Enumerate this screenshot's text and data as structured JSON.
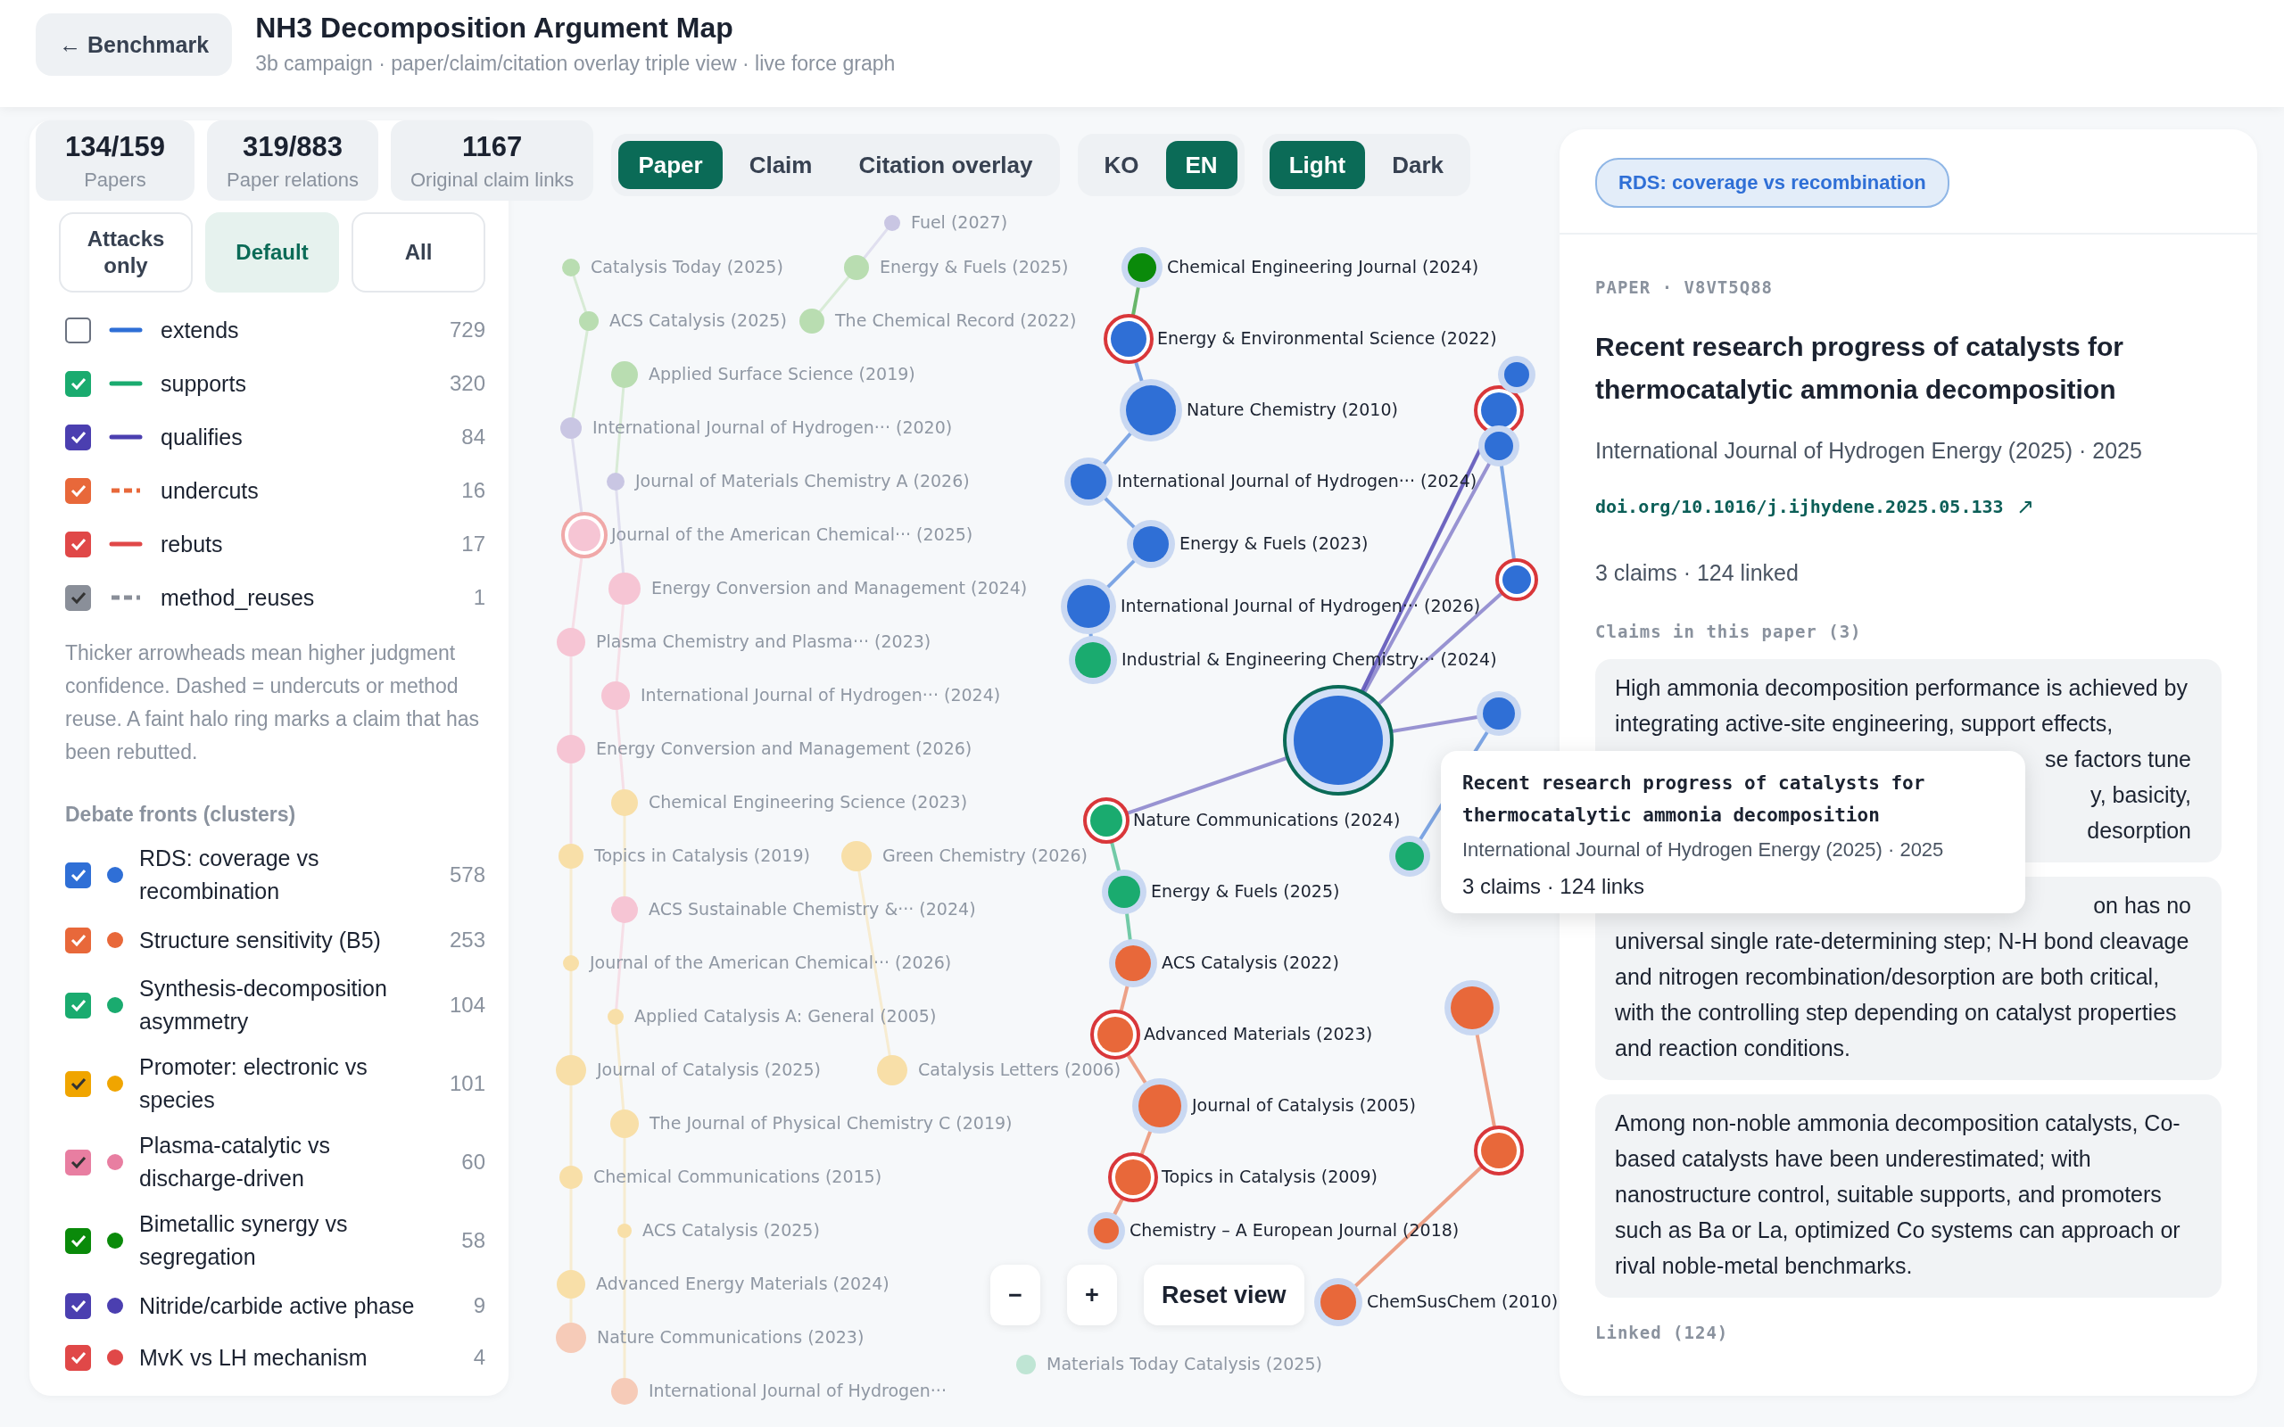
{
  "header": {
    "back_button": "← Benchmark",
    "title": "NH3 Decomposition Argument Map",
    "subtitle": "3b campaign · paper/claim/citation overlay triple view · live force graph"
  },
  "stats": [
    {
      "value": "134/159",
      "label": "Papers"
    },
    {
      "value": "319/883",
      "label": "Paper relations"
    },
    {
      "value": "1167",
      "label": "Original claim links"
    }
  ],
  "view_tabs": [
    {
      "label": "Paper",
      "selected": true
    },
    {
      "label": "Claim",
      "selected": false
    },
    {
      "label": "Citation overlay",
      "selected": false
    }
  ],
  "language": [
    {
      "label": "KO",
      "selected": false
    },
    {
      "label": "EN",
      "selected": true
    }
  ],
  "theme": [
    {
      "label": "Light",
      "selected": true
    },
    {
      "label": "Dark",
      "selected": false
    }
  ],
  "filters": [
    {
      "label": "Attacks only",
      "selected": false
    },
    {
      "label": "Default",
      "selected": true
    },
    {
      "label": "All",
      "selected": false
    }
  ],
  "edge_types": [
    {
      "label": "extends",
      "color": "#2f6fd6",
      "kind": "solid",
      "checked": false,
      "count": "729"
    },
    {
      "label": "supports",
      "color": "#1aab6f",
      "kind": "solid",
      "checked": true,
      "count": "320"
    },
    {
      "label": "qualifies",
      "color": "#4b3fb0",
      "kind": "solid",
      "checked": true,
      "count": "84"
    },
    {
      "label": "undercuts",
      "color": "#e8683a",
      "kind": "dashed",
      "checked": true,
      "count": "16"
    },
    {
      "label": "rebuts",
      "color": "#e04848",
      "kind": "solid",
      "checked": true,
      "count": "17"
    },
    {
      "label": "method_reuses",
      "color": "#8a8f99",
      "kind": "dashed",
      "checked": true,
      "count": "1"
    }
  ],
  "legend_note": "Thicker arrowheads mean higher judgment confidence. Dashed = undercuts or method reuse. A faint halo ring marks a claim that has been rebutted.",
  "clusters_title": "Debate fronts (clusters)",
  "clusters": [
    {
      "label": "RDS: coverage vs recombination",
      "color": "#2f6fd6",
      "checked": true,
      "count": "578"
    },
    {
      "label": "Structure sensitivity (B5)",
      "color": "#e8683a",
      "checked": true,
      "count": "253"
    },
    {
      "label": "Synthesis-decomposition asymmetry",
      "color": "#1aab6f",
      "checked": true,
      "count": "104"
    },
    {
      "label": "Promoter: electronic vs species",
      "color": "#f0a500",
      "checked": true,
      "count": "101"
    },
    {
      "label": "Plasma-catalytic vs discharge-driven",
      "color": "#e87ea1",
      "checked": true,
      "count": "60"
    },
    {
      "label": "Bimetallic synergy vs segregation",
      "color": "#0a8a0a",
      "checked": true,
      "count": "58"
    },
    {
      "label": "Nitride/carbide active phase",
      "color": "#4b3fb0",
      "checked": true,
      "count": "9"
    },
    {
      "label": "MvK vs LH mechanism",
      "color": "#e04848",
      "checked": true,
      "count": "4"
    }
  ],
  "graph": {
    "nodes": [
      {
        "label": "Fuel (2027)",
        "color": "#c9c6e3",
        "active": false,
        "rebutted": false
      },
      {
        "label": "Catalysis Today (2025)",
        "color": "#b9ddb1",
        "active": false,
        "rebutted": false
      },
      {
        "label": "Energy & Fuels (2025)",
        "color": "#b9ddb1",
        "active": false,
        "rebutted": false
      },
      {
        "label": "ACS Catalysis (2025)",
        "color": "#b9ddb1",
        "active": false,
        "rebutted": false
      },
      {
        "label": "The Chemical Record (2022)",
        "color": "#b9ddb1",
        "active": false,
        "rebutted": false
      },
      {
        "label": "Applied Surface Science (2019)",
        "color": "#b9ddb1",
        "active": false,
        "rebutted": false
      },
      {
        "label": "International Journal of Hydrogen··· (2020)",
        "color": "#c9c6e3",
        "active": false,
        "rebutted": false
      },
      {
        "label": "Journal of Materials Chemistry A (2026)",
        "color": "#c9c6e3",
        "active": false,
        "rebutted": false
      },
      {
        "label": "Journal of the American Chemical··· (2025)",
        "color": "#f6c5d4",
        "active": false,
        "rebutted": true
      },
      {
        "label": "Energy Conversion and Management (2024)",
        "color": "#f6c5d4",
        "active": false,
        "rebutted": false
      },
      {
        "label": "Plasma Chemistry and Plasma··· (2023)",
        "color": "#f6c5d4",
        "active": false,
        "rebutted": false
      },
      {
        "label": "International Journal of Hydrogen··· (2024)",
        "color": "#f6c5d4",
        "active": false,
        "rebutted": false
      },
      {
        "label": "Energy Conversion and Management (2026)",
        "color": "#f6c5d4",
        "active": false,
        "rebutted": false
      },
      {
        "label": "Chemical Engineering Science (2023)",
        "color": "#f8dfa8",
        "active": false,
        "rebutted": false
      },
      {
        "label": "Topics in Catalysis (2019)",
        "color": "#f8dfa8",
        "active": false,
        "rebutted": false
      },
      {
        "label": "Green Chemistry (2026)",
        "color": "#f8dfa8",
        "active": false,
        "rebutted": false
      },
      {
        "label": "ACS Sustainable Chemistry &··· (2024)",
        "color": "#f6c5d4",
        "active": false,
        "rebutted": false
      },
      {
        "label": "Journal of the American Chemical··· (2026)",
        "color": "#f8dfa8",
        "active": false,
        "rebutted": false
      },
      {
        "label": "Applied Catalysis A: General (2005)",
        "color": "#f8dfa8",
        "active": false,
        "rebutted": false
      },
      {
        "label": "Journal of Catalysis (2025)",
        "color": "#f8dfa8",
        "active": false,
        "rebutted": false
      },
      {
        "label": "Catalysis Letters (2006)",
        "color": "#f8dfa8",
        "active": false,
        "rebutted": false
      },
      {
        "label": "The Journal of Physical Chemistry C (2019)",
        "color": "#f8dfa8",
        "active": false,
        "rebutted": false
      },
      {
        "label": "Chemical Communications (2015)",
        "color": "#f8dfa8",
        "active": false,
        "rebutted": false
      },
      {
        "label": "ACS Catalysis (2025)",
        "color": "#f8dfa8",
        "active": false,
        "rebutted": false
      },
      {
        "label": "Advanced Energy Materials (2024)",
        "color": "#f8dfa8",
        "active": false,
        "rebutted": false
      },
      {
        "label": "Nature Communications (2023)",
        "color": "#f6cbb8",
        "active": false,
        "rebutted": false
      },
      {
        "label": "International Journal of Hydrogen···",
        "color": "#f6cbb8",
        "active": false,
        "rebutted": false
      },
      {
        "label": "Materials Today Catalysis (2025)",
        "color": "#bfe5d4",
        "active": false,
        "rebutted": false
      },
      {
        "label": "Chemical Engineering Journal (2024)",
        "color": "#0a8a0a",
        "active": true,
        "rebutted": false
      },
      {
        "label": "Energy & Environmental Science (2022)",
        "color": "#2f6fd6",
        "active": true,
        "rebutted": true
      },
      {
        "label": "Nature Chemistry (2010)",
        "color": "#2f6fd6",
        "active": true,
        "rebutted": false
      },
      {
        "label": "International Journal of Hydrogen··· (2024)",
        "color": "#2f6fd6",
        "active": true,
        "rebutted": false
      },
      {
        "label": "Energy & Fuels (2023)",
        "color": "#2f6fd6",
        "active": true,
        "rebutted": false
      },
      {
        "label": "International Journal of Hydrogen··· (2026)",
        "color": "#2f6fd6",
        "active": true,
        "rebutted": false
      },
      {
        "label": "Industrial & Engineering Chemistry··· (2024)",
        "color": "#1aab6f",
        "active": true,
        "rebutted": false
      },
      {
        "label": "Nature Communications (2024)",
        "color": "#1aab6f",
        "active": true,
        "rebutted": true
      },
      {
        "label": "Energy & Fuels (2025)",
        "color": "#1aab6f",
        "active": true,
        "rebutted": false
      },
      {
        "label": "ACS Catalysis (2022)",
        "color": "#e8683a",
        "active": true,
        "rebutted": false
      },
      {
        "label": "Advanced Materials (2023)",
        "color": "#e8683a",
        "active": true,
        "rebutted": true
      },
      {
        "label": "Journal of Catalysis (2005)",
        "color": "#e8683a",
        "active": true,
        "rebutted": false
      },
      {
        "label": "Topics in Catalysis (2009)",
        "color": "#e8683a",
        "active": true,
        "rebutted": true
      },
      {
        "label": "Chemistry – A European Journal (2018)",
        "color": "#e8683a",
        "active": true,
        "rebutted": false
      },
      {
        "label": "ChemSusChem (2010)",
        "color": "#e8683a",
        "active": true,
        "rebutted": false
      },
      {
        "color": "#2f6fd6",
        "active": true,
        "rebutted": true
      },
      {
        "color": "#2f6fd6",
        "active": true,
        "rebutted": false
      },
      {
        "color": "#2f6fd6",
        "active": true,
        "rebutted": false
      },
      {
        "color": "#2f6fd6",
        "active": true,
        "rebutted": true
      },
      {
        "color": "#2f6fd6",
        "active": true,
        "rebutted": false
      },
      {
        "color": "#1aab6f",
        "active": true,
        "rebutted": false
      },
      {
        "color": "#e8683a",
        "active": true,
        "rebutted": false
      },
      {
        "color": "#e8683a",
        "active": true,
        "rebutted": true
      }
    ],
    "focus_node": {
      "color": "#2f6fd6"
    }
  },
  "zoom_controls": [
    "−",
    "+",
    "Reset view"
  ],
  "tooltip": {
    "title": "Recent research progress of catalysts for thermocatalytic ammonia decomposition",
    "venue": "International Journal of Hydrogen Energy (2025) · 2025",
    "meta": "3 claims · 124 links"
  },
  "detail": {
    "cluster_badge": "RDS: coverage vs recombination",
    "eyebrow": "PAPER · V8VT5Q88",
    "title": "Recent research progress of catalysts for thermocatalytic ammonia decomposition",
    "venue": "International Journal of Hydrogen Energy (2025) · 2025",
    "doi": "doi.org/10.1016/j.ijhydene.2025.05.133",
    "doi_icon": "↗",
    "meta": "3 claims · 124 linked",
    "claims_title": "Claims in this paper (3)",
    "claims": [
      {
        "text": "High ammonia decomposition performance is achieved by integrating active-site engineering, support effects,",
        "tail_fragments": [
          "se factors tune",
          "y, basicity,",
          "desorption"
        ]
      },
      {
        "head_fragments": [
          "on has no"
        ],
        "text": "universal single rate-determining step; N-H bond cleavage and nitrogen recombination/desorption are both critical, with the controlling step depending on catalyst properties and reaction conditions."
      },
      {
        "text": "Among non-noble ammonia decomposition catalysts, Co-based catalysts have been underestimated; with nanostructure control, suitable supports, and promoters such as Ba or La, optimized Co systems can approach or rival noble-metal benchmarks."
      }
    ],
    "linked_title": "Linked (124)"
  }
}
